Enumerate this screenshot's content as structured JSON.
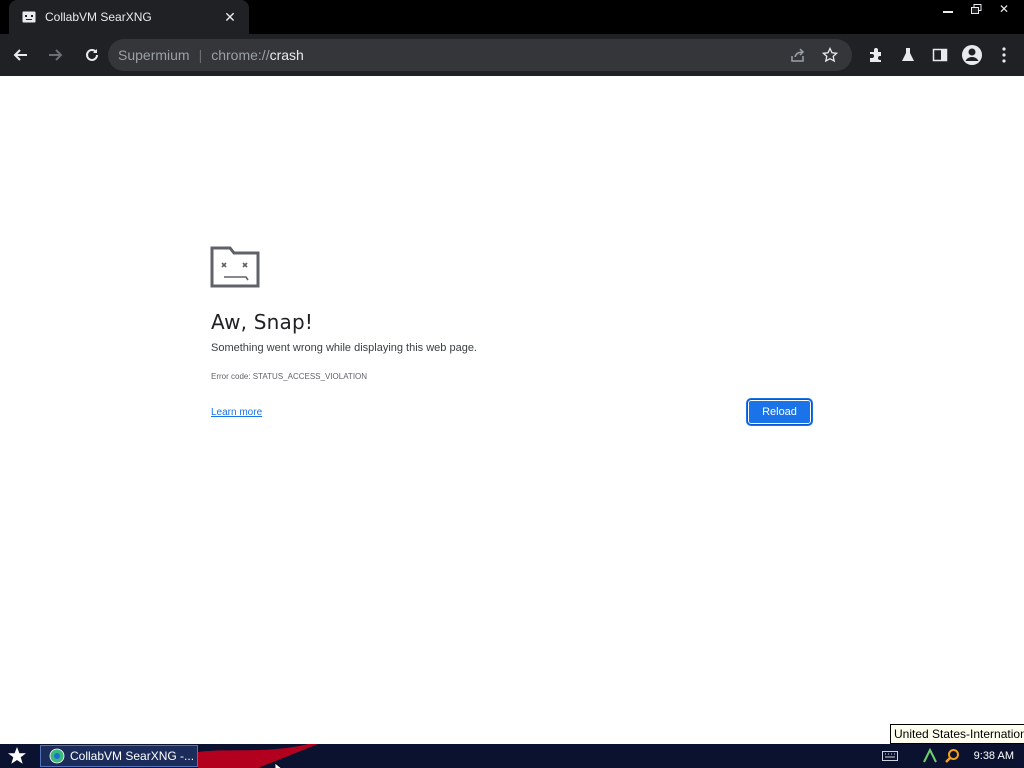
{
  "browser": {
    "tab": {
      "title": "CollabVM SearXNG",
      "favicon": "sad-tab-icon"
    },
    "window_controls": [
      "minimize-icon",
      "restore-icon",
      "close-icon"
    ],
    "omnibox": {
      "origin": "Supermium",
      "separator": "|",
      "scheme": "chrome://",
      "path": "crash"
    },
    "toolbar_icons": [
      "share-icon",
      "star-icon",
      "extensions-icon",
      "labs-icon",
      "side-panel-icon",
      "profile-icon",
      "menu-icon"
    ]
  },
  "page": {
    "heading": "Aw, Snap!",
    "message": "Something went wrong while displaying this web page.",
    "error_code": "Error code: STATUS_ACCESS_VIOLATION",
    "learn_more": "Learn more",
    "reload": "Reload"
  },
  "tooltip": {
    "keyboard_layout": "United States-International"
  },
  "taskbar": {
    "task_label": "CollabVM SearXNG -...",
    "clock": "9:38 AM"
  },
  "colors": {
    "accent": "#1a73e8",
    "chrome_bg": "#202124",
    "omnibox_bg": "#35363a",
    "taskbar_bg": "#0b1230"
  }
}
